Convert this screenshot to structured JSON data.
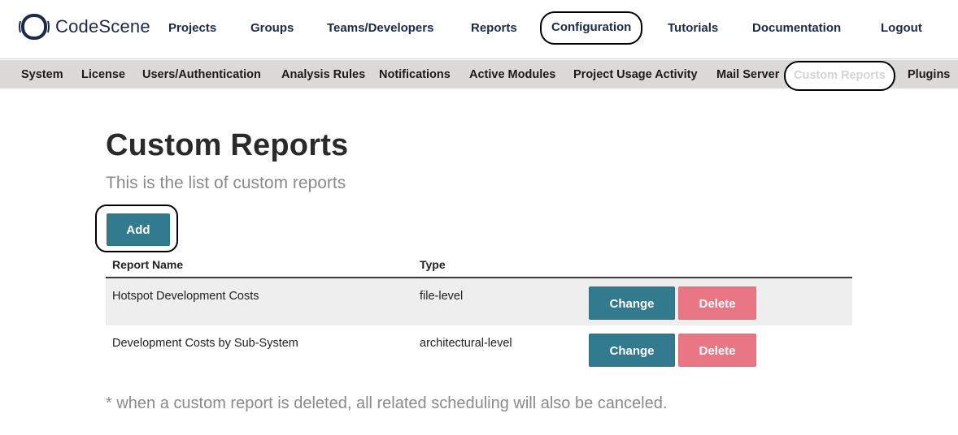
{
  "app": {
    "name": "CodeScene",
    "logo_icon": "codescene-helmet-icon"
  },
  "topnav": {
    "items": [
      {
        "label": "Projects"
      },
      {
        "label": "Groups"
      },
      {
        "label": "Teams/Developers"
      },
      {
        "label": "Reports"
      },
      {
        "label": "Configuration",
        "active": true
      },
      {
        "label": "Tutorials"
      },
      {
        "label": "Documentation"
      },
      {
        "label": "Logout"
      }
    ]
  },
  "subnav": {
    "items": [
      {
        "label": "System"
      },
      {
        "label": "License"
      },
      {
        "label": "Users/Authentication"
      },
      {
        "label": "Analysis Rules"
      },
      {
        "label": "Notifications"
      },
      {
        "label": "Active Modules"
      },
      {
        "label": "Project Usage Activity"
      },
      {
        "label": "Mail Server"
      },
      {
        "label": "Custom Reports",
        "active": true
      },
      {
        "label": "Plugins"
      }
    ]
  },
  "main": {
    "title": "Custom Reports",
    "subtitle": "This is the list of custom reports",
    "add_label": "Add",
    "table": {
      "columns": [
        "Report Name",
        "Type"
      ],
      "rows": [
        {
          "name": "Hotspot Development Costs",
          "type": "file-level",
          "change_label": "Change",
          "delete_label": "Delete"
        },
        {
          "name": "Development Costs by Sub-System",
          "type": "architectural-level",
          "change_label": "Change",
          "delete_label": "Delete"
        }
      ]
    },
    "footnote": "* when a custom report is deleted, all related scheduling will also be canceled."
  },
  "colors": {
    "primary": "#327a8d",
    "danger": "#e87684",
    "nav_text": "#1c2a4a",
    "subnav_bg": "#dcdad8"
  }
}
